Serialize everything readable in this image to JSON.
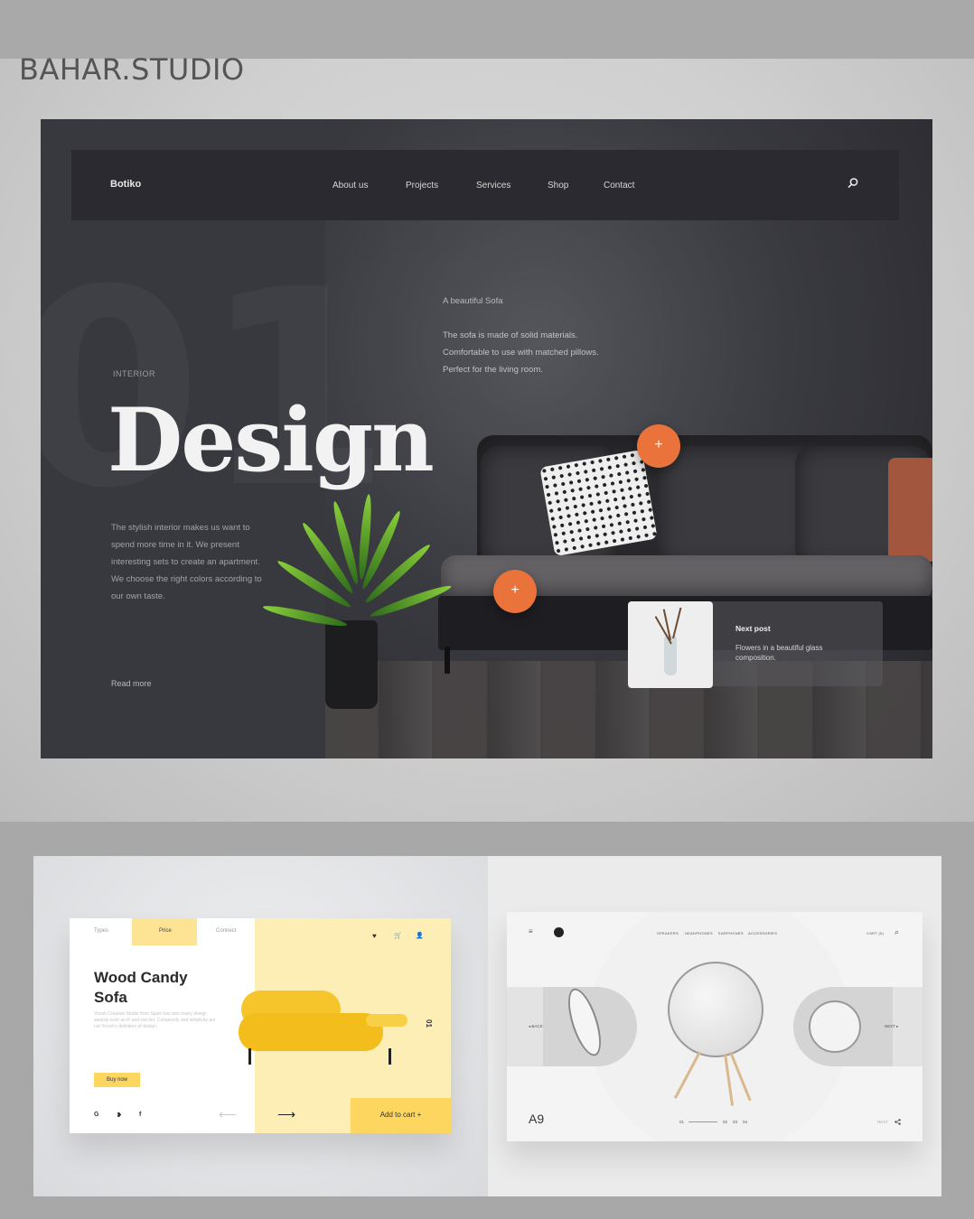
{
  "brand": "BAHAR.STUDIO",
  "hero": {
    "logo": "Botiko",
    "nav": [
      "About us",
      "Projects",
      "Services",
      "Shop",
      "Contact"
    ],
    "eyebrow": "INTERIOR",
    "big_number": "01",
    "headline": "Design",
    "description": "The stylish interior makes us want to spend more time in it. We present interesting sets to create an apartment. We choose the right colors according to our own taste.",
    "read_more": "Read more",
    "sofa_title": "A beautiful Sofa",
    "sofa_lines": [
      "The sofa is made of solid materials.",
      "Comfortable to use with matched pillows.",
      "Perfect for the living room."
    ],
    "hotspot_symbol": "+",
    "next_post_title": "Next post",
    "next_post_desc": "Flowers in a beautiful glass composition.",
    "accent_color": "#e9733a"
  },
  "wood_candy": {
    "tabs": [
      "Types",
      "Price",
      "Connect"
    ],
    "title": "Wood Candy Sofa",
    "desc": "Yonoh Creative Studio from Spain has won many design awards such as iF and red dot. Complexity and simplicity are not Yonoh's definition of design.",
    "buy_label": "Buy now",
    "socials": [
      "G",
      "❥",
      "f"
    ],
    "arrow_prev": "⟵",
    "arrow_next": "⟶",
    "cart_label": "Add to cart  +",
    "number": "01",
    "icons": [
      "♥",
      "🛒",
      "👤"
    ],
    "accent_color": "#fcd65e"
  },
  "a9": {
    "nav": [
      "SPEAKERS",
      "HEADPHONES",
      "EARPHONES",
      "ACCESSORIES"
    ],
    "cart": "CART (0)",
    "back": "◂  BACK",
    "next": "NEXT  ▸",
    "label": "A9",
    "pager": [
      "01",
      "02",
      "03",
      "04"
    ],
    "bottom_right": "NEXT",
    "menu_icon": "≡",
    "search_icon": "⌕"
  }
}
